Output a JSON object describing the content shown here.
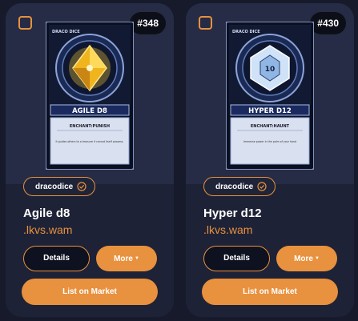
{
  "colors": {
    "accent": "#e8913e",
    "card_bg": "#1f2438",
    "page_bg": "#161a2b"
  },
  "cards": [
    {
      "number": "#348",
      "collection": "dracodice",
      "name": "Agile d8",
      "owner": ".lkvs.wam",
      "art_title": "AGILE D8",
      "art_brand": "DRACO DICE",
      "art_ability": "ENCHANT:PUNISH",
      "art_text": "It guides others to a treasure it cannot itself possess.",
      "details_label": "Details",
      "more_label": "More",
      "list_label": "List on Market"
    },
    {
      "number": "#430",
      "collection": "dracodice",
      "name": "Hyper d12",
      "owner": ".lkvs.wam",
      "art_title": "HYPER D12",
      "art_brand": "DRACO DICE",
      "art_ability": "ENCHANT:HAUNT",
      "art_text": "Immense power in the palm of your hand",
      "details_label": "Details",
      "more_label": "More",
      "list_label": "List on Market"
    }
  ]
}
